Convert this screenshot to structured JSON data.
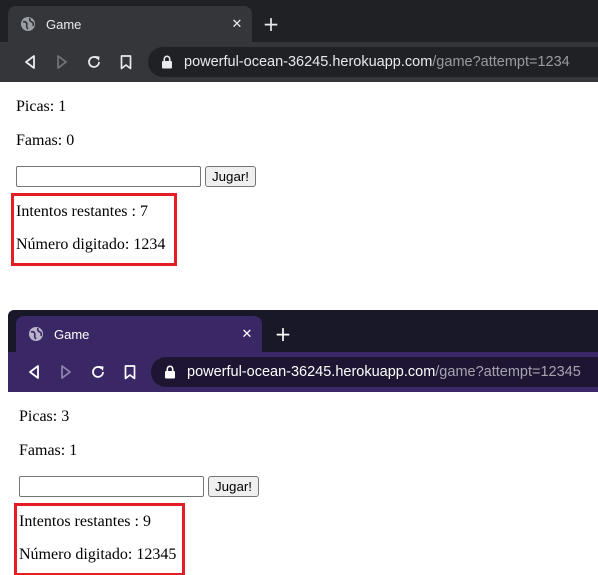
{
  "screenshots": [
    {
      "tab": {
        "title": "Game",
        "close_icon": "close-icon",
        "favicon": "globe-icon"
      },
      "newtab_icon": "plus-icon",
      "url": {
        "host": "powerful-ocean-36245.herokuapp.com",
        "path": "/game?attempt=1234"
      },
      "page": {
        "picas": "Picas: 1",
        "famas": "Famas: 0",
        "input_value": "",
        "button_label": "Jugar!",
        "intentos": "Intentos restantes : 7",
        "numero": "Número digitado: 1234"
      },
      "highlight_color": "#e31e24"
    },
    {
      "tab": {
        "title": "Game",
        "close_icon": "close-icon",
        "favicon": "globe-icon"
      },
      "newtab_icon": "plus-icon",
      "url": {
        "host": "powerful-ocean-36245.herokuapp.com",
        "path": "/game?attempt=12345"
      },
      "page": {
        "picas": "Picas: 3",
        "famas": "Famas: 1",
        "input_value": "",
        "button_label": "Jugar!",
        "intentos": "Intentos restantes : 9",
        "numero": "Número digitado: 12345"
      },
      "highlight_color": "#e31e24"
    }
  ],
  "theme": {
    "dark_frame": "#35363a",
    "purple_frame": "#3a2766"
  }
}
